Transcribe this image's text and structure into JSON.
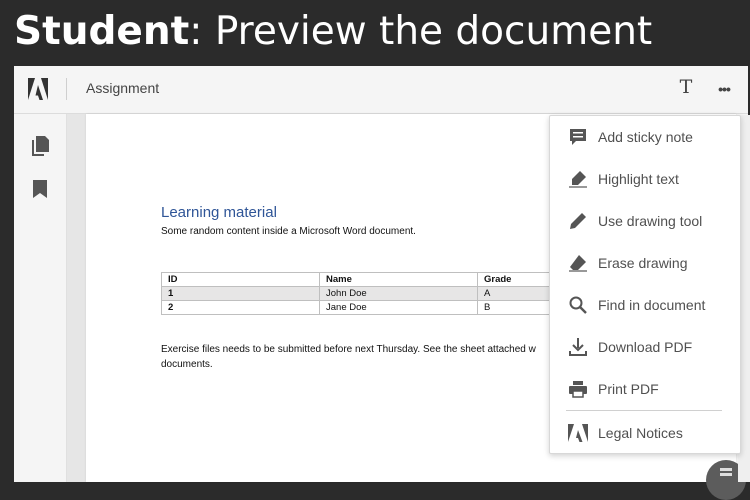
{
  "banner": {
    "title_bold": "Student",
    "title_rest": ": Preview the document"
  },
  "toolbar": {
    "document_name": "Assignment",
    "text_tool_label": "T",
    "more_label": "•••"
  },
  "document": {
    "heading": "Learning material",
    "subtitle": "Some random content inside a Microsoft Word document.",
    "table": {
      "headers": [
        "ID",
        "Name",
        "Grade"
      ],
      "rows": [
        [
          "1",
          "John Doe",
          "A"
        ],
        [
          "2",
          "Jane Doe",
          "B"
        ]
      ]
    },
    "paragraph_line1": "Exercise files needs to be submitted before next Thursday. See the sheet attached w",
    "paragraph_line2": "documents."
  },
  "menu": {
    "items": [
      {
        "label": "Add sticky note",
        "icon": "sticky-note-icon"
      },
      {
        "label": "Highlight text",
        "icon": "highlighter-icon"
      },
      {
        "label": "Use drawing tool",
        "icon": "pencil-icon"
      },
      {
        "label": "Erase drawing",
        "icon": "eraser-icon"
      },
      {
        "label": "Find in document",
        "icon": "search-icon"
      },
      {
        "label": "Download PDF",
        "icon": "download-icon"
      },
      {
        "label": "Print PDF",
        "icon": "printer-icon"
      },
      {
        "label": "Legal Notices",
        "icon": "adobe-logo-icon"
      }
    ]
  },
  "colors": {
    "heading": "#2f5597",
    "banner_bg": "#2b2b2b",
    "menu_text": "#505050"
  }
}
